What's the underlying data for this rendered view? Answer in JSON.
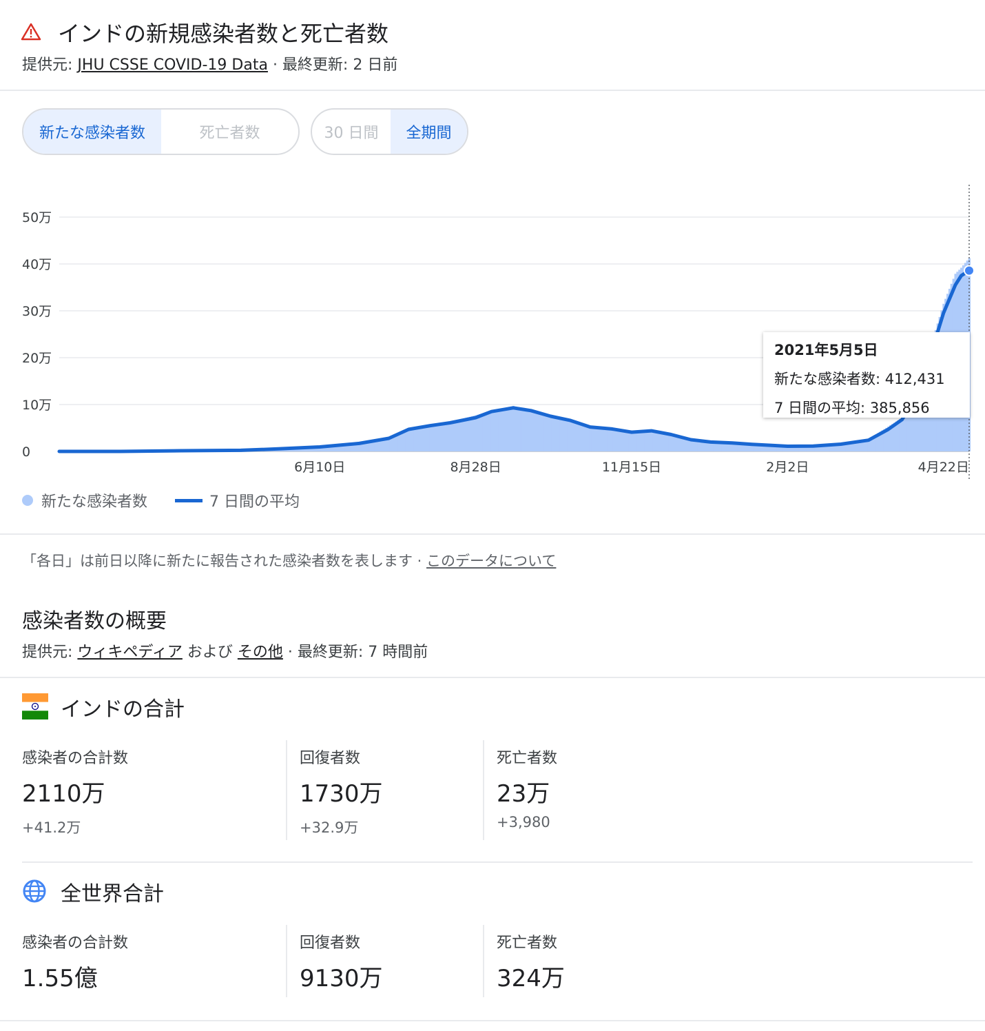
{
  "header": {
    "title": "インドの新規感染者数と死亡者数",
    "source_prefix": "提供元: ",
    "source_link": "JHU CSSE COVID-19 Data",
    "source_suffix": " · 最終更新: 2 日前"
  },
  "toggles": {
    "metric": [
      "新たな感染者数",
      "死亡者数"
    ],
    "metric_selected": "新たな感染者数",
    "range": [
      "30 日間",
      "全期間"
    ],
    "range_selected": "全期間"
  },
  "colors": {
    "bars": "#aecbfa",
    "line": "#1967d2",
    "warning": "#d93025",
    "accent_bg": "#e8f0fe"
  },
  "chart_data": {
    "type": "bar",
    "title": "",
    "xlabel": "",
    "ylabel": "",
    "y_tick_labels": [
      "0",
      "10万",
      "20万",
      "30万",
      "40万",
      "50万"
    ],
    "y_ticks": [
      0,
      100000,
      200000,
      300000,
      400000,
      500000
    ],
    "ylim": [
      0,
      500000
    ],
    "x_tick_labels": [
      "6月10日",
      "8月28日",
      "11月15日",
      "2月2日",
      "4月22日"
    ],
    "x_tick_dates": [
      "2020-06-10",
      "2020-08-28",
      "2020-11-15",
      "2021-02-02",
      "2021-04-22"
    ],
    "x_range": [
      "2020-01-30",
      "2021-05-05"
    ],
    "grid": true,
    "legend_position": "bottom-left",
    "series": [
      {
        "name": "新たな感染者数",
        "type": "bar",
        "color": "#aecbfa",
        "x": [
          "2020-01-30",
          "2020-03-01",
          "2020-04-01",
          "2020-05-01",
          "2020-05-20",
          "2020-06-10",
          "2020-06-30",
          "2020-07-15",
          "2020-07-25",
          "2020-08-05",
          "2020-08-15",
          "2020-08-28",
          "2020-09-05",
          "2020-09-16",
          "2020-09-25",
          "2020-10-05",
          "2020-10-15",
          "2020-10-25",
          "2020-11-05",
          "2020-11-15",
          "2020-11-25",
          "2020-12-05",
          "2020-12-15",
          "2020-12-25",
          "2021-01-05",
          "2021-01-15",
          "2021-01-25",
          "2021-02-02",
          "2021-02-15",
          "2021-03-01",
          "2021-03-15",
          "2021-03-25",
          "2021-04-01",
          "2021-04-08",
          "2021-04-15",
          "2021-04-22",
          "2021-04-28",
          "2021-05-01",
          "2021-05-05"
        ],
        "values": [
          0,
          50,
          2000,
          2500,
          6000,
          10000,
          19000,
          30000,
          49000,
          56000,
          63000,
          77000,
          87000,
          97000,
          86000,
          74000,
          65000,
          50000,
          49000,
          41000,
          44000,
          36000,
          24000,
          19000,
          18000,
          15000,
          13000,
          11000,
          12000,
          16000,
          26000,
          53000,
          72000,
          126000,
          217000,
          315000,
          379000,
          392000,
          412431
        ]
      },
      {
        "name": "7 日間の平均",
        "type": "line",
        "color": "#1967d2",
        "x": [
          "2020-01-30",
          "2020-03-01",
          "2020-04-01",
          "2020-05-01",
          "2020-05-20",
          "2020-06-10",
          "2020-06-30",
          "2020-07-15",
          "2020-07-25",
          "2020-08-05",
          "2020-08-15",
          "2020-08-28",
          "2020-09-05",
          "2020-09-16",
          "2020-09-25",
          "2020-10-05",
          "2020-10-15",
          "2020-10-25",
          "2020-11-05",
          "2020-11-15",
          "2020-11-25",
          "2020-12-05",
          "2020-12-15",
          "2020-12-25",
          "2021-01-05",
          "2021-01-15",
          "2021-01-25",
          "2021-02-02",
          "2021-02-15",
          "2021-03-01",
          "2021-03-15",
          "2021-03-25",
          "2021-04-01",
          "2021-04-08",
          "2021-04-15",
          "2021-04-22",
          "2021-04-28",
          "2021-05-01",
          "2021-05-05"
        ],
        "values": [
          0,
          30,
          1500,
          2300,
          5500,
          9500,
          17000,
          28000,
          47000,
          55000,
          61000,
          72000,
          85000,
          93000,
          87000,
          75000,
          66000,
          52000,
          48000,
          41000,
          44000,
          36000,
          25000,
          20000,
          18000,
          15000,
          13000,
          11000,
          11500,
          15500,
          24000,
          47000,
          68000,
          115000,
          200000,
          295000,
          355000,
          375000,
          385856
        ]
      }
    ],
    "highlight": {
      "date_label": "2021年5月5日",
      "new_cases_label": "新たな感染者数",
      "new_cases_value": "412,431",
      "avg_label": "7 日間の平均",
      "avg_value": "385,856"
    }
  },
  "legend": {
    "bars": "新たな感染者数",
    "line": "7 日間の平均"
  },
  "note": {
    "text": "「各日」は前日以降に新たに報告された感染者数を表します · ",
    "link": "このデータについて"
  },
  "summary": {
    "title": "感染者数の概要",
    "source_prefix": "提供元: ",
    "source_link1": "ウィキペディア",
    "source_mid": " および ",
    "source_link2": "その他",
    "source_suffix": " · 最終更新: 7 時間前"
  },
  "india": {
    "title": "インドの合計",
    "stats": [
      {
        "label": "感染者の合計数",
        "value": "2110万",
        "delta": "+41.2万"
      },
      {
        "label": "回復者数",
        "value": "1730万",
        "delta": "+32.9万"
      },
      {
        "label": "死亡者数",
        "value": "23万",
        "delta": "+3,980"
      }
    ]
  },
  "world": {
    "title": "全世界合計",
    "stats": [
      {
        "label": "感染者の合計数",
        "value": "1.55億"
      },
      {
        "label": "回復者数",
        "value": "9130万"
      },
      {
        "label": "死亡者数",
        "value": "324万"
      }
    ]
  }
}
